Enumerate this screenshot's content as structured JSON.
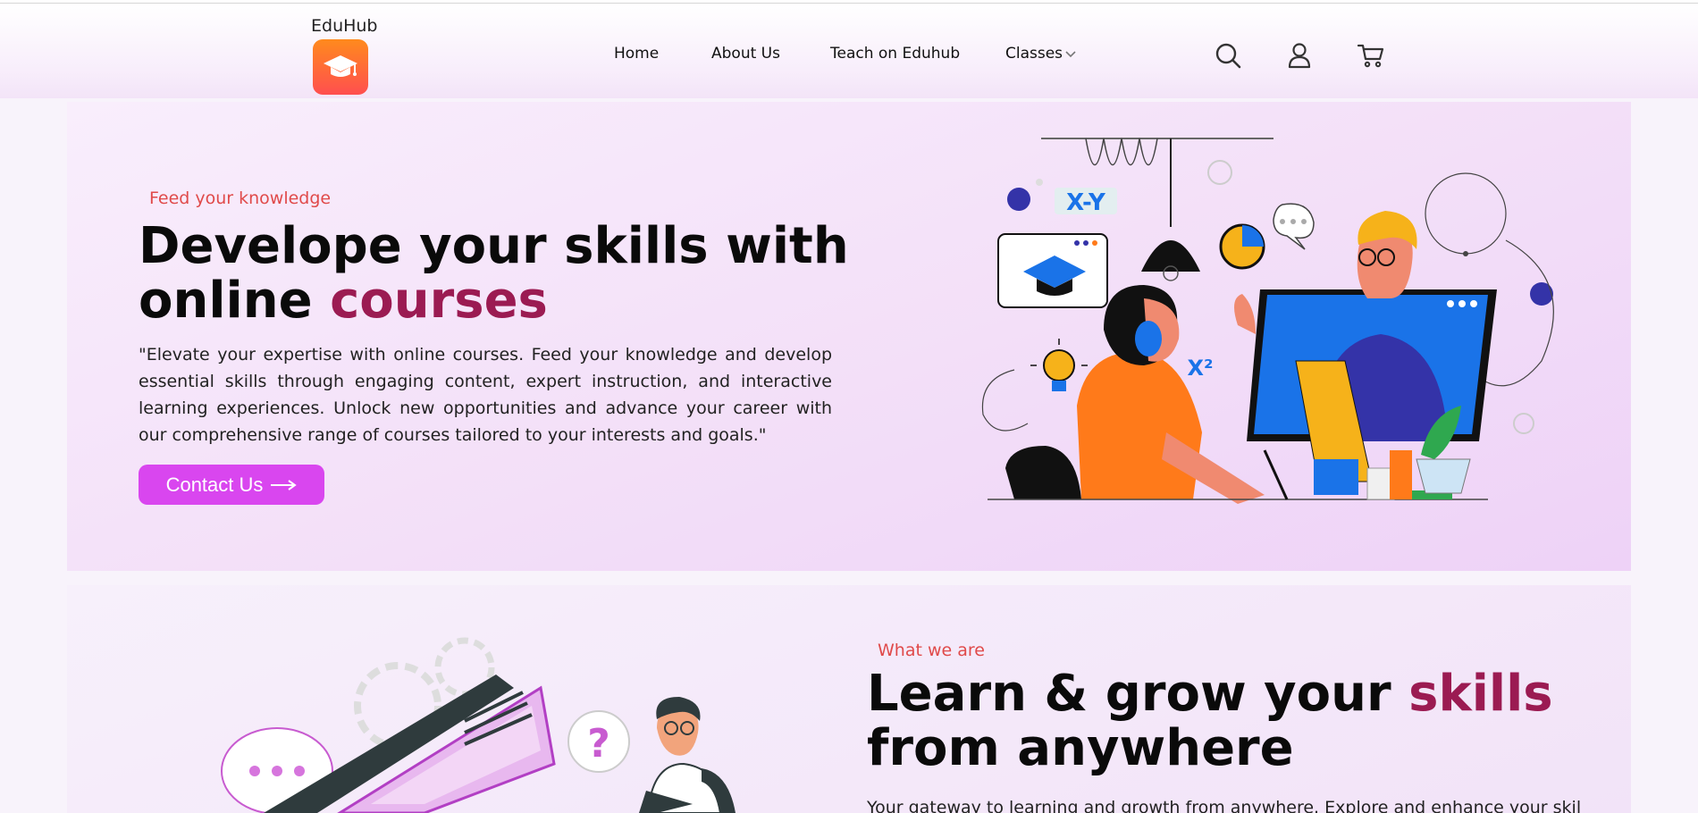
{
  "brand": {
    "name": "EduHub"
  },
  "nav": {
    "home": "Home",
    "about": "About Us",
    "teach": "Teach on Eduhub",
    "classes": "Classes"
  },
  "icons": {
    "logo": "graduation-cap-icon",
    "search": "search-icon",
    "user": "user-icon",
    "cart": "cart-icon",
    "chevron": "chevron-down-icon"
  },
  "hero": {
    "eyebrow": "Feed your knowledge",
    "title_line1": "Develope your skills with",
    "title_line2_plain": "online ",
    "title_line2_accent": "courses",
    "paragraph": "\"Elevate your expertise with online courses. Feed your knowledge and develop essential skills through engaging content, expert instruction, and interactive learning experiences. Unlock new opportunities and advance your career with our comprehensive range of courses tailored to your interests and goals.\"",
    "cta_label": "Contact Us",
    "illustration": {
      "formula_1": "X-Y",
      "formula_2": "X²"
    }
  },
  "about": {
    "eyebrow": "What we are",
    "title_line1_plain": "Learn & grow your ",
    "title_line1_accent": "skills",
    "title_line2": "from anywhere",
    "paragraph": "Your gateway to learning and growth from anywhere. Explore and enhance your skills",
    "illustration": {
      "question_mark": "?"
    }
  },
  "colors": {
    "accent": "#9b1b52",
    "eyebrow": "#e04a4a",
    "cta": "#d946ef",
    "logo_gradient_top": "#ff8a1d",
    "logo_gradient_bottom": "#ff4f4f"
  }
}
